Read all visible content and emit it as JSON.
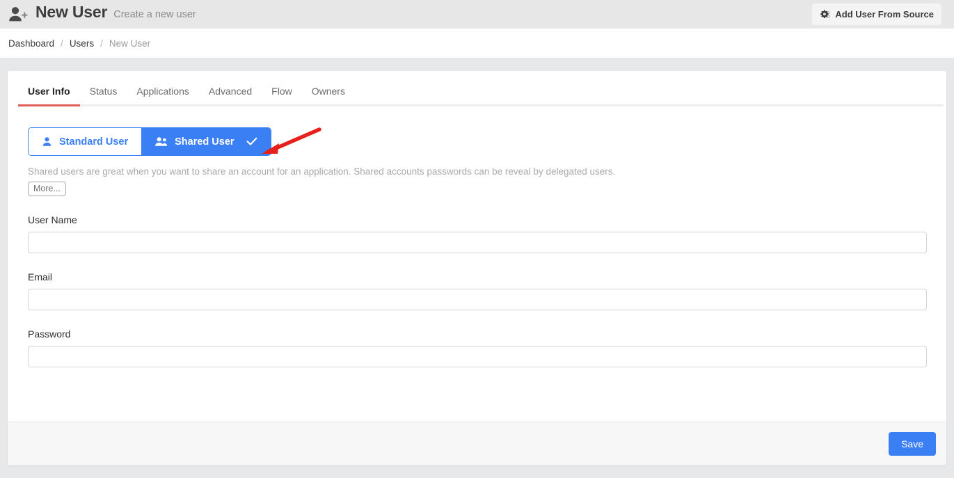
{
  "header": {
    "icon": "user-plus-icon",
    "title": "New User",
    "subtitle": "Create a new user",
    "action_button": {
      "icon": "cogs-icon",
      "label": "Add User From Source"
    }
  },
  "breadcrumb": {
    "separator": "/",
    "items": [
      {
        "label": "Dashboard",
        "current": false
      },
      {
        "label": "Users",
        "current": false
      },
      {
        "label": "New User",
        "current": true
      }
    ]
  },
  "tabs": [
    {
      "label": "User Info",
      "active": true
    },
    {
      "label": "Status",
      "active": false
    },
    {
      "label": "Applications",
      "active": false
    },
    {
      "label": "Advanced",
      "active": false
    },
    {
      "label": "Flow",
      "active": false
    },
    {
      "label": "Owners",
      "active": false
    }
  ],
  "user_type": {
    "options": [
      {
        "label": "Standard User",
        "icon": "user-icon",
        "selected": false
      },
      {
        "label": "Shared User",
        "icon": "users-icon",
        "selected": true,
        "check_icon": "check-icon"
      }
    ],
    "help_text": "Shared users are great when you want to share an account for an application. Shared accounts passwords can be reveal by delegated users.",
    "more_label": "More..."
  },
  "form": {
    "fields": [
      {
        "label": "User Name",
        "value": "",
        "placeholder": "",
        "type": "text",
        "name": "user-name-input"
      },
      {
        "label": "Email",
        "value": "",
        "placeholder": "",
        "type": "text",
        "name": "email-input"
      },
      {
        "label": "Password",
        "value": "",
        "placeholder": "",
        "type": "password",
        "name": "password-input"
      }
    ]
  },
  "footer": {
    "save_label": "Save"
  },
  "annotation": {
    "type": "arrow",
    "color": "#e8201c",
    "points_to": "Shared User"
  },
  "colors": {
    "accent_blue": "#3b7ff5",
    "tab_active_underline": "#e05c56",
    "header_bg": "#e7e7e8",
    "page_bg": "#e7e8ea",
    "annotation_red": "#e8201c"
  }
}
